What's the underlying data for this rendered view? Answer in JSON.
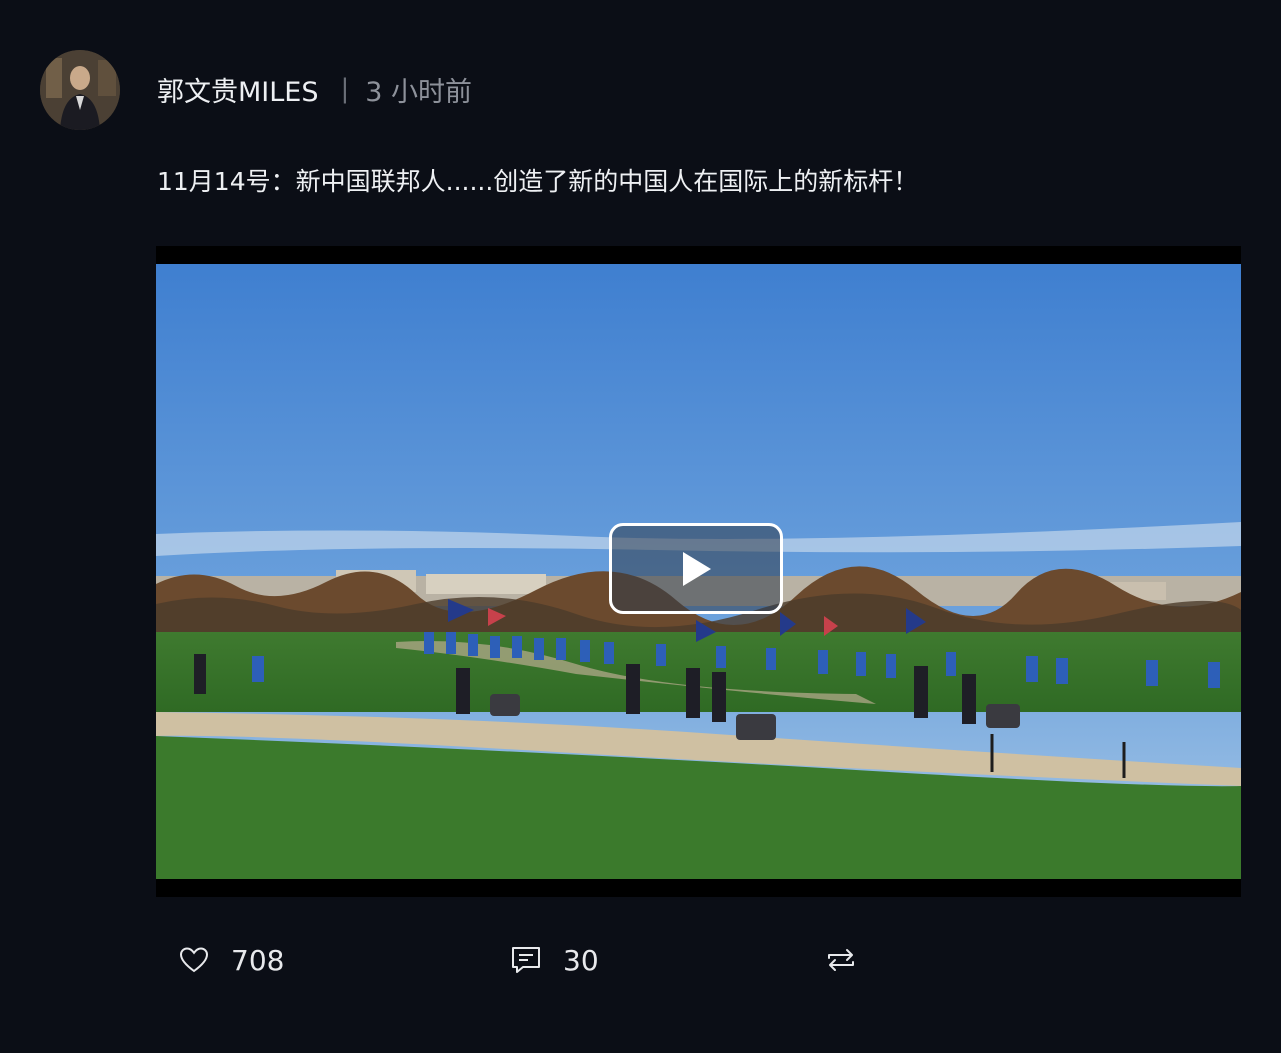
{
  "post": {
    "author": "郭文贵MILES",
    "separator": "|",
    "time": "3 小时前",
    "text": "11月14号：新中国联邦人......创造了新的中国人在国际上的新标杆！"
  },
  "avatar": {
    "icon": "user-avatar"
  },
  "video": {
    "icon": "play-icon"
  },
  "actions": {
    "like": {
      "icon": "heart-icon",
      "count": "708"
    },
    "comment": {
      "icon": "comment-icon",
      "count": "30"
    },
    "repost": {
      "icon": "repost-icon"
    }
  },
  "colors": {
    "background": "#0b0e16",
    "text": "#eef0f3",
    "muted": "#8d919a"
  }
}
